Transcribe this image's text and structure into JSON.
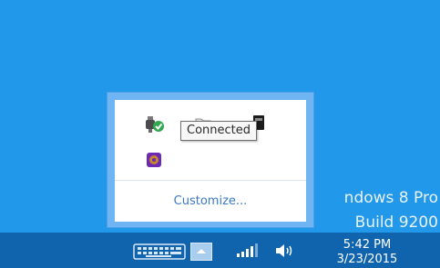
{
  "tray_flyout": {
    "customize_label": "Customize...",
    "icons": [
      "usb-connected-icon",
      "folder-icon",
      "battery-icon",
      "app-icon"
    ]
  },
  "tooltip": {
    "text": "Connected"
  },
  "watermark": {
    "line1": "ndows 8 Pro",
    "line2": "Build 9200"
  },
  "taskbar": {
    "clock": {
      "time": "5:42 PM",
      "date": "3/23/2015"
    },
    "icons": [
      "touch-keyboard-icon",
      "show-hidden-icons-chevron",
      "network-signal-icon",
      "volume-icon"
    ]
  },
  "colors": {
    "desktop": "#2198ea",
    "taskbar": "#0f64ad",
    "link": "#3a79c3"
  }
}
